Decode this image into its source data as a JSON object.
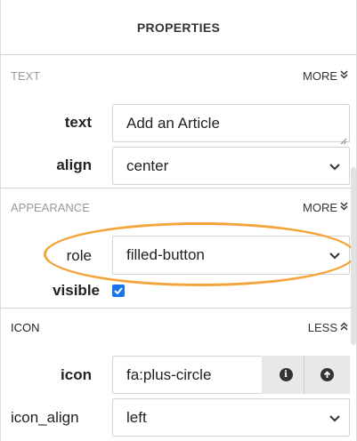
{
  "header": {
    "title": "PROPERTIES"
  },
  "text_section": {
    "title": "TEXT",
    "more_label": "MORE",
    "text_label": "text",
    "text_value": "Add an Article",
    "align_label": "align",
    "align_value": "center"
  },
  "appearance_section": {
    "title": "APPEARANCE",
    "more_label": "MORE",
    "role_label": "role",
    "role_value": "filled-button",
    "visible_label": "visible",
    "visible_checked": true
  },
  "icon_section": {
    "title": "ICON",
    "less_label": "LESS",
    "icon_label": "icon",
    "icon_value": "fa:plus-circle",
    "icon_align_label": "icon_align",
    "icon_align_value": "left"
  },
  "colors": {
    "highlight": "#f5a43c",
    "checkbox": "#1a73e8",
    "muted_title": "#999999"
  }
}
